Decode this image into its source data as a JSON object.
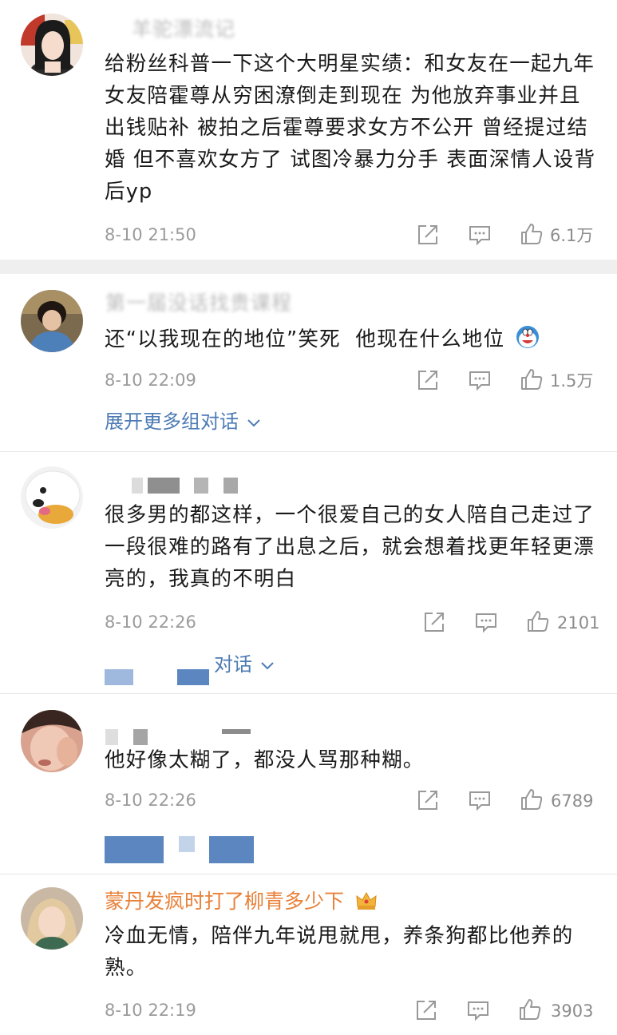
{
  "comments": [
    {
      "username": "羊驼漂流记",
      "text": "给粉丝科普一下这个大明星实绩：和女友在一起九年 女友陪霍尊从穷困潦倒走到现在 为他放弃事业并且出钱贴补 被拍之后霍尊要求女方不公开 曾经提过结婚 但不喜欢女方了 试图冷暴力分手 表面深情人设背后yp",
      "time": "8-10 21:50",
      "likes": "6.1万"
    },
    {
      "username": "第一届没话找贵课程",
      "text": "还“以我现在的地位”笑死  他现在什么地位",
      "time": "8-10 22:09",
      "likes": "1.5万",
      "expand": "展开更多组对话"
    },
    {
      "text": "很多男的都这样，一个很爱自己的女人陪自己走过了一段很难的路有了出息之后，就会想着找更年轻更漂亮的，我真的不明白",
      "time": "8-10 22:26",
      "likes": "2101",
      "expand": "对话"
    },
    {
      "text": "他好像太糊了，都没人骂那种糊。",
      "time": "8-10 22:26",
      "likes": "6789"
    },
    {
      "username": "蒙丹发疯时打了柳青多少下",
      "text": "冷血无情，陪伴九年说甩就甩，养条狗都比他养的熟。",
      "time": "8-10 22:19",
      "likes": "3903"
    }
  ],
  "icons": {
    "share": "share-icon",
    "reply": "comment-icon",
    "like": "thumbs-up-icon",
    "crown": "crown-badge-icon",
    "emoji": "doraemon-emoji-icon",
    "chevron": "chevron-down-icon"
  },
  "colors": {
    "link": "#4d7bb5",
    "vip_name": "#e8813a",
    "meta": "#9b9b9b",
    "mosaic": "#5b86c0"
  }
}
